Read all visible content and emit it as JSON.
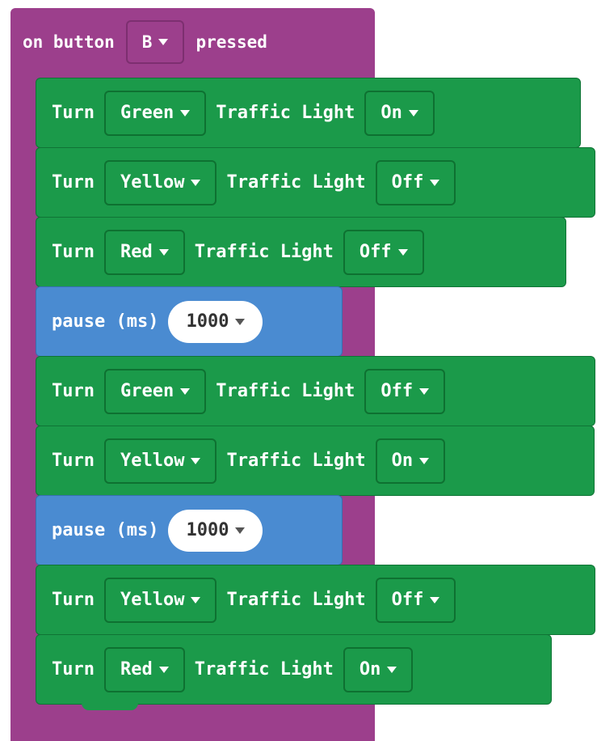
{
  "event": {
    "prefix": "on button",
    "button": "B",
    "suffix": "pressed"
  },
  "blocks": [
    {
      "type": "turn",
      "word": "Turn",
      "color": "Green",
      "label": "Traffic Light",
      "state": "On"
    },
    {
      "type": "turn",
      "word": "Turn",
      "color": "Yellow",
      "label": "Traffic Light",
      "state": "Off"
    },
    {
      "type": "turn",
      "word": "Turn",
      "color": "Red",
      "label": "Traffic Light",
      "state": "Off"
    },
    {
      "type": "pause",
      "label": "pause (ms)",
      "value": "1000"
    },
    {
      "type": "turn",
      "word": "Turn",
      "color": "Green",
      "label": "Traffic Light",
      "state": "Off"
    },
    {
      "type": "turn",
      "word": "Turn",
      "color": "Yellow",
      "label": "Traffic Light",
      "state": "On"
    },
    {
      "type": "pause",
      "label": "pause (ms)",
      "value": "1000"
    },
    {
      "type": "turn",
      "word": "Turn",
      "color": "Yellow",
      "label": "Traffic Light",
      "state": "Off"
    },
    {
      "type": "turn",
      "word": "Turn",
      "color": "Red",
      "label": "Traffic Light",
      "state": "On"
    }
  ],
  "colors": {
    "event": "#9c3f8c",
    "action": "#1b9a4a",
    "pause": "#4a8bd1"
  },
  "icons": {
    "dropdown": "caret-down-icon"
  }
}
